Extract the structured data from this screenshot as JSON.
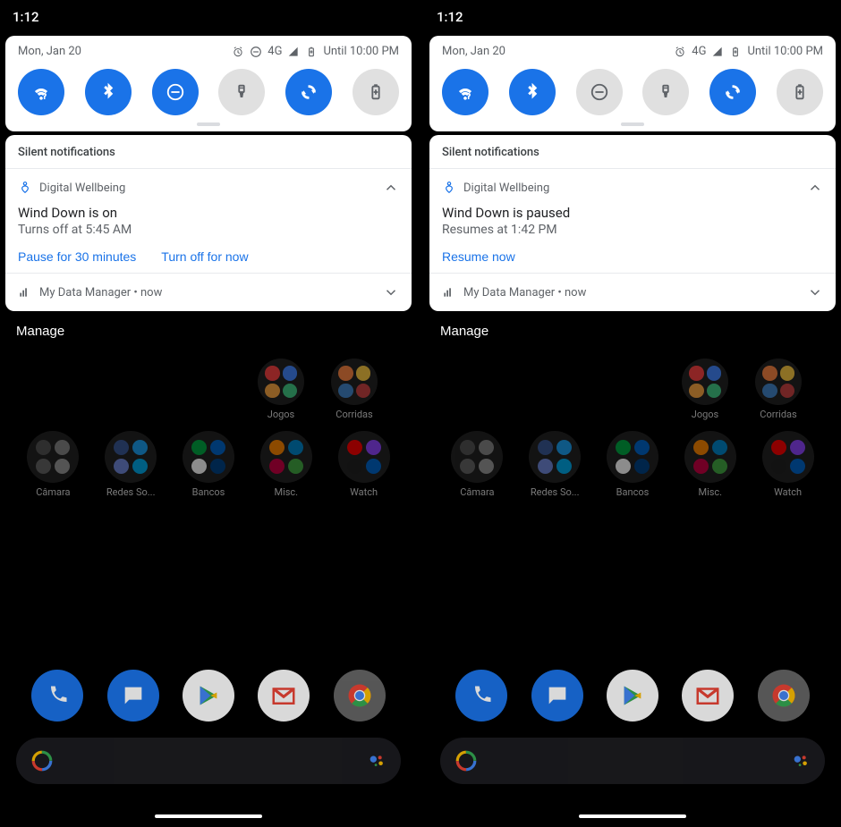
{
  "left": {
    "time": "1:12",
    "date": "Mon, Jan 20",
    "battery_until": "Until 10:00 PM",
    "network_label": "4G",
    "show_dnd_status": true,
    "tiles": [
      {
        "name": "wifi",
        "on": true
      },
      {
        "name": "bluetooth",
        "on": true
      },
      {
        "name": "dnd",
        "on": true
      },
      {
        "name": "flashlight",
        "on": false
      },
      {
        "name": "autorotate",
        "on": true
      },
      {
        "name": "battery-saver",
        "on": false
      }
    ],
    "silent_header": "Silent notifications",
    "wellbeing": {
      "app": "Digital Wellbeing",
      "title": "Wind Down is on",
      "sub": "Turns off at 5:45 AM",
      "actions": [
        "Pause for 30 minutes",
        "Turn off for now"
      ]
    },
    "collapsed": {
      "app": "My Data Manager",
      "when": "now"
    },
    "manage": "Manage",
    "folders_top": [
      "Jogos",
      "Corridas"
    ],
    "folders": [
      "Câmara",
      "Redes So...",
      "Bancos",
      "Misc.",
      "Watch"
    ]
  },
  "right": {
    "time": "1:12",
    "date": "Mon, Jan 20",
    "battery_until": "Until 10:00 PM",
    "network_label": "4G",
    "show_dnd_status": false,
    "tiles": [
      {
        "name": "wifi",
        "on": true
      },
      {
        "name": "bluetooth",
        "on": true
      },
      {
        "name": "dnd",
        "on": false
      },
      {
        "name": "flashlight",
        "on": false
      },
      {
        "name": "autorotate",
        "on": true
      },
      {
        "name": "battery-saver",
        "on": false
      }
    ],
    "silent_header": "Silent notifications",
    "wellbeing": {
      "app": "Digital Wellbeing",
      "title": "Wind Down is paused",
      "sub": "Resumes at 1:42 PM",
      "actions": [
        "Resume now"
      ]
    },
    "collapsed": {
      "app": "My Data Manager",
      "when": "now"
    },
    "manage": "Manage",
    "folders_top": [
      "Jogos",
      "Corridas"
    ],
    "folders": [
      "Câmara",
      "Redes So...",
      "Bancos",
      "Misc.",
      "Watch"
    ]
  }
}
